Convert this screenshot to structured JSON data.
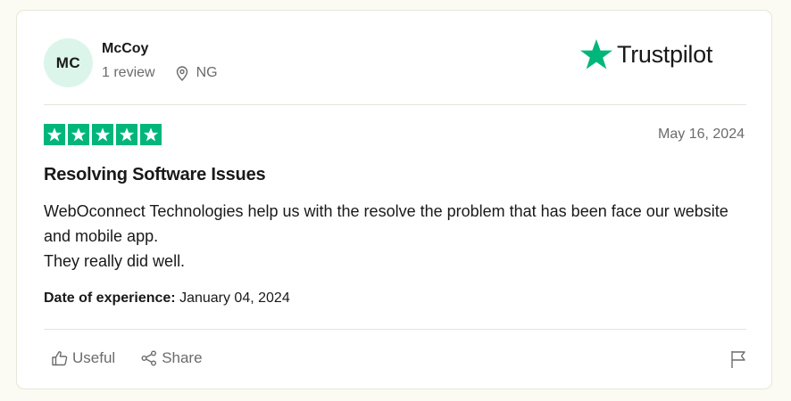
{
  "reviewer": {
    "initials": "MC",
    "name": "McCoy",
    "review_count": "1 review",
    "country": "NG"
  },
  "brand": {
    "logo_text": "Trustpilot",
    "accent_color": "#00b67a",
    "logo_star_icon": "star-icon"
  },
  "review": {
    "rating": 5,
    "rating_max": 5,
    "date": "May 16, 2024",
    "title": "Resolving Software Issues",
    "body_line_1": "WebOconnect Technologies help us with the resolve the problem that has been face our website and mobile app.",
    "body_line_2": "They really did well.",
    "experience_label": "Date of experience:",
    "experience_date": "January 04, 2024"
  },
  "actions": {
    "useful_label": "Useful",
    "share_label": "Share",
    "useful_icon": "thumbs-up-icon",
    "share_icon": "share-icon",
    "flag_icon": "flag-icon"
  }
}
